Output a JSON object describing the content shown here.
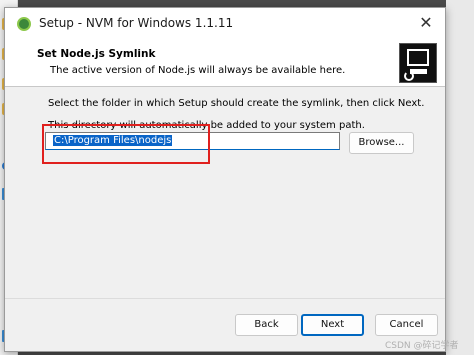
{
  "window": {
    "title": "Setup - NVM for Windows 1.1.11",
    "close_glyph": "✕"
  },
  "header": {
    "title": "Set Node.js Symlink",
    "subtitle": "The active version of Node.js will always be available here."
  },
  "body": {
    "instruction": "Select the folder in which Setup should create the symlink, then click Next.",
    "note": "This directory will automatically be added to your system path.",
    "path_value": "C:\\Program Files\\nodejs",
    "browse_label": "Browse..."
  },
  "footer": {
    "back_label": "Back",
    "next_label": "Next",
    "cancel_label": "Cancel"
  },
  "watermark": "CSDN @碎记学者",
  "colors": {
    "selection": "#0a64c8",
    "annotation": "#e0201e",
    "default_button_border": "#0067c0"
  },
  "icons": [
    "nvm-app-icon",
    "close-icon",
    "computer-logo-icon",
    "folder-icon",
    "cloud-icon",
    "monitor-icon"
  ]
}
